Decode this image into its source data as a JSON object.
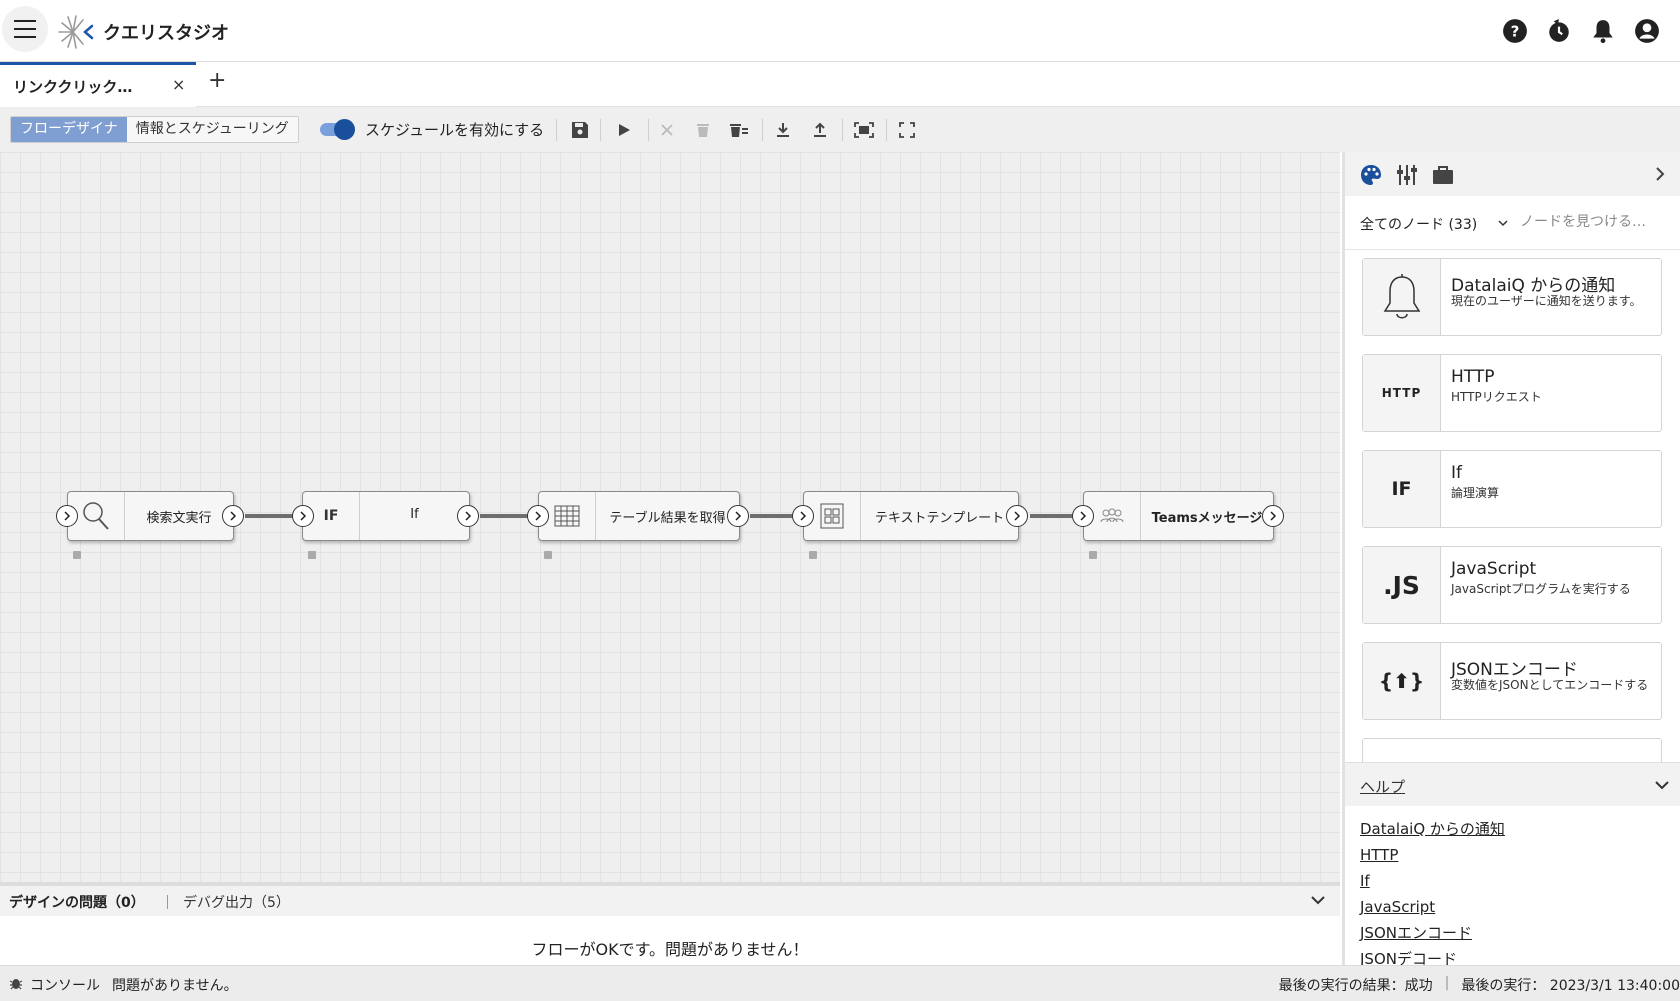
{
  "app": {
    "title": "クエリスタジオ"
  },
  "tabs": [
    {
      "label": "リンククリック…",
      "close": "×"
    }
  ],
  "tab_add": "+",
  "toolbar": {
    "mode_flow": "フローデザイナ",
    "mode_info": "情報とスケジューリング",
    "schedule_label": "スケジュールを有効にする",
    "schedule_enabled": true
  },
  "flow": {
    "nodes": [
      {
        "label": "検索文実行",
        "icon": "search-icon"
      },
      {
        "label": "If",
        "icon_text": "IF"
      },
      {
        "label": "テーブル結果を取得",
        "icon": "table-icon"
      },
      {
        "label": "テキストテンプレート",
        "icon": "template-icon"
      },
      {
        "label": "Teamsメッセージ",
        "icon": "teams-icon"
      }
    ]
  },
  "bottom_panel": {
    "tab_issues": "デザインの問題（0）",
    "tab_debug": "デバグ出力（5）",
    "message": "フローがOKです。問題がありません！"
  },
  "right_panel": {
    "filter_label": "全てのノード (33)",
    "search_placeholder": "ノードを見つける…",
    "palette": [
      {
        "title": "DatalaiQ からの通知",
        "desc": "現在のユーザーに通知を送ります。",
        "icon": "bell-icon"
      },
      {
        "title": "HTTP",
        "desc": "HTTPリクエスト",
        "icon_text": "HTTP"
      },
      {
        "title": "If",
        "desc": "論理演算",
        "icon_text": "IF"
      },
      {
        "title": "JavaScript",
        "desc": "JavaScriptプログラムを実行する",
        "icon_text": ".JS"
      },
      {
        "title": "JSONエンコード",
        "desc": "変数値をJSONとしてエンコードする",
        "icon_text": "{⬆}"
      }
    ],
    "help_title": "ヘルプ",
    "help_links": [
      "DatalaiQ からの通知",
      "HTTP",
      "If",
      "JavaScript",
      "JSONエンコード",
      "JSONデコード"
    ]
  },
  "statusbar": {
    "console": "コンソール",
    "message": "問題がありません。",
    "last_result": "最後の実行の結果：成功",
    "last_run": "最後の実行： 2023/3/1 13:40:00"
  },
  "colors": {
    "accent": "#1a4f9c",
    "tab_accent": "#1a56a8",
    "mode_active": "#7f9ed1"
  }
}
